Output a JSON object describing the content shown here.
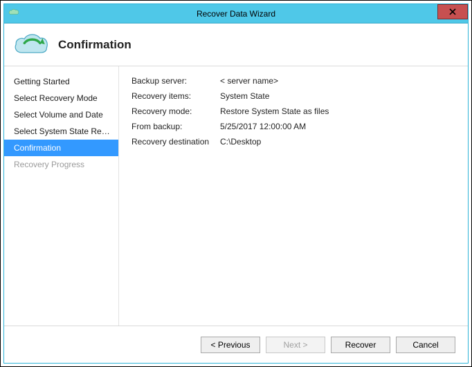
{
  "window": {
    "title": "Recover Data Wizard"
  },
  "header": {
    "title": "Confirmation"
  },
  "sidebar": {
    "steps": [
      {
        "label": "Getting Started",
        "state": "done"
      },
      {
        "label": "Select Recovery Mode",
        "state": "done"
      },
      {
        "label": "Select Volume and Date",
        "state": "done"
      },
      {
        "label": "Select System State Reco...",
        "state": "done"
      },
      {
        "label": "Confirmation",
        "state": "selected"
      },
      {
        "label": "Recovery Progress",
        "state": "disabled"
      }
    ]
  },
  "details": {
    "rows": [
      {
        "label": "Backup server:",
        "value": "< server name>"
      },
      {
        "label": "Recovery items:",
        "value": "System State"
      },
      {
        "label": "Recovery mode:",
        "value": "Restore System State as files"
      },
      {
        "label": "From backup:",
        "value": "5/25/2017 12:00:00 AM"
      },
      {
        "label": "Recovery destination",
        "value": "C:\\Desktop"
      }
    ]
  },
  "footer": {
    "previous": "< Previous",
    "next": "Next >",
    "recover": "Recover",
    "cancel": "Cancel"
  }
}
